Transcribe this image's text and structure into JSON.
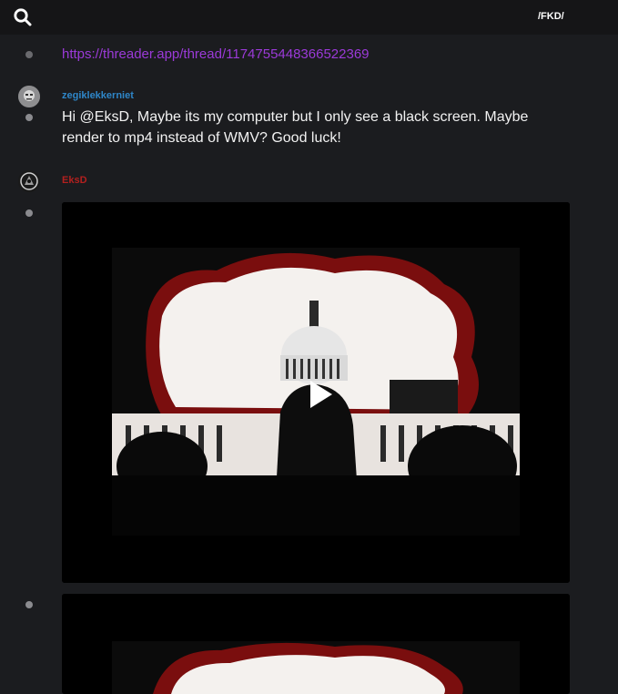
{
  "header": {
    "search_icon": "search-icon",
    "board": "/FKD/"
  },
  "posts": [
    {
      "type": "link",
      "url": "https://threader.app/thread/1174755448366522369"
    },
    {
      "type": "text",
      "username": "zegiklekkerniet",
      "username_color": "#2e86c8",
      "message": "Hi @EksD, Maybe its my computer but I only see a black screen. Maybe render to mp4 instead of WMV? Good luck!"
    },
    {
      "type": "video",
      "username": "EksD",
      "username_color": "#b3201f",
      "video_icon": "play-icon"
    },
    {
      "type": "video",
      "video_icon": "video-thumbnail"
    }
  ],
  "colors": {
    "background": "#1b1c1f",
    "topbar": "#151517",
    "link": "#9b3ad8",
    "accent_red": "#b3201f"
  }
}
